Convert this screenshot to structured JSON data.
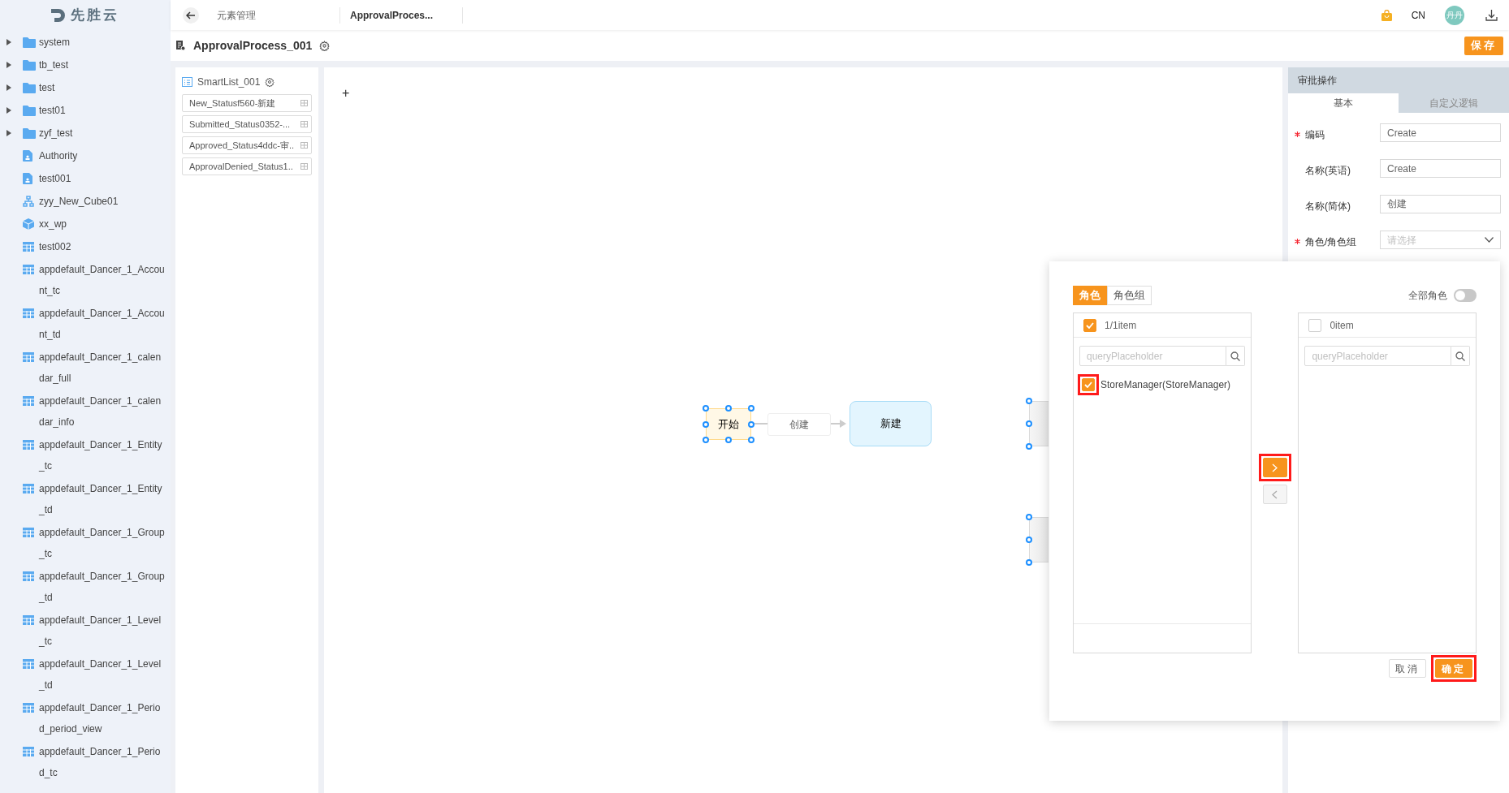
{
  "sidebar": {
    "logo": "先胜云",
    "items": [
      {
        "label": "system",
        "kind": "folder",
        "expanded": false
      },
      {
        "label": "tb_test",
        "kind": "folder",
        "expanded": false
      },
      {
        "label": "test",
        "kind": "folder",
        "expanded": false
      },
      {
        "label": "test01",
        "kind": "folder",
        "expanded": false
      },
      {
        "label": "zyf_test",
        "kind": "folder",
        "expanded": false
      },
      {
        "label": "Authority",
        "kind": "document"
      },
      {
        "label": "test001",
        "kind": "document"
      },
      {
        "label": "zyy_New_Cube01",
        "kind": "hierarchy"
      },
      {
        "label": "xx_wp",
        "kind": "cube"
      },
      {
        "label": "test002",
        "kind": "table"
      },
      {
        "label": "appdefault_Dancer_1_Account_tc",
        "kind": "table"
      },
      {
        "label": "appdefault_Dancer_1_Account_td",
        "kind": "table"
      },
      {
        "label": "appdefault_Dancer_1_calendar_full",
        "kind": "table"
      },
      {
        "label": "appdefault_Dancer_1_calendar_info",
        "kind": "table"
      },
      {
        "label": "appdefault_Dancer_1_Entity_tc",
        "kind": "table"
      },
      {
        "label": "appdefault_Dancer_1_Entity_td",
        "kind": "table"
      },
      {
        "label": "appdefault_Dancer_1_Group_tc",
        "kind": "table"
      },
      {
        "label": "appdefault_Dancer_1_Group_td",
        "kind": "table"
      },
      {
        "label": "appdefault_Dancer_1_Level_tc",
        "kind": "table"
      },
      {
        "label": "appdefault_Dancer_1_Level_td",
        "kind": "table"
      },
      {
        "label": "appdefault_Dancer_1_Period_period_view",
        "kind": "table"
      },
      {
        "label": "appdefault_Dancer_1_Period_tc",
        "kind": "table"
      }
    ]
  },
  "topbar": {
    "breadcrumbs": [
      "元素管理",
      "ApprovalProces..."
    ],
    "language": "CN",
    "avatar": "丹丹"
  },
  "header": {
    "title": "ApprovalProcess_001",
    "save": "保存"
  },
  "smartlist": {
    "title": "SmartList_001",
    "items": [
      "New_Statusf560-新建",
      "Submitted_Status0352-...",
      "Approved_Status4ddc-审..",
      "ApprovalDenied_Status1.."
    ]
  },
  "canvas": {
    "add": "+",
    "edge_label": "创建",
    "nodes": [
      {
        "kind": "start",
        "label": "开始",
        "selected": true
      },
      {
        "kind": "state",
        "label": "新建",
        "selected": false
      },
      {
        "kind": "partial",
        "selected": true
      },
      {
        "kind": "partial",
        "selected": true
      }
    ]
  },
  "properties": {
    "title": "审批操作",
    "tabs": [
      {
        "label": "基本",
        "selected": true
      },
      {
        "label": "自定义逻辑",
        "selected": false
      }
    ],
    "fields": [
      {
        "kind": "input",
        "label": "编码",
        "required": true,
        "value": "Create"
      },
      {
        "kind": "input",
        "label": "名称(英语)",
        "required": false,
        "value": "Create"
      },
      {
        "kind": "input",
        "label": "名称(简体)",
        "required": false,
        "value": "创建"
      },
      {
        "kind": "select",
        "label": "角色/角色组",
        "required": true,
        "placeholder": "请选择"
      }
    ]
  },
  "dialog": {
    "tabs": [
      {
        "label": "角色",
        "selected": true
      },
      {
        "label": "角色组",
        "selected": false
      }
    ],
    "all_roles": {
      "label": "全部角色",
      "on": false
    },
    "source": {
      "count": "1/1item",
      "checked": true,
      "placeholder": "queryPlaceholder",
      "items": [
        {
          "label": "StoreManager(StoreManager)",
          "checked": true,
          "highlighted": true
        }
      ]
    },
    "target": {
      "count": "0item",
      "checked": false,
      "placeholder": "queryPlaceholder"
    },
    "move_buttons": [
      {
        "kind": "right",
        "disabled": false,
        "highlighted": true
      },
      {
        "kind": "left",
        "disabled": true,
        "highlighted": false
      }
    ],
    "buttons": [
      {
        "kind": "secondary",
        "label": "取消",
        "highlighted": false
      },
      {
        "kind": "primary",
        "label": "确定",
        "highlighted": true
      }
    ]
  }
}
